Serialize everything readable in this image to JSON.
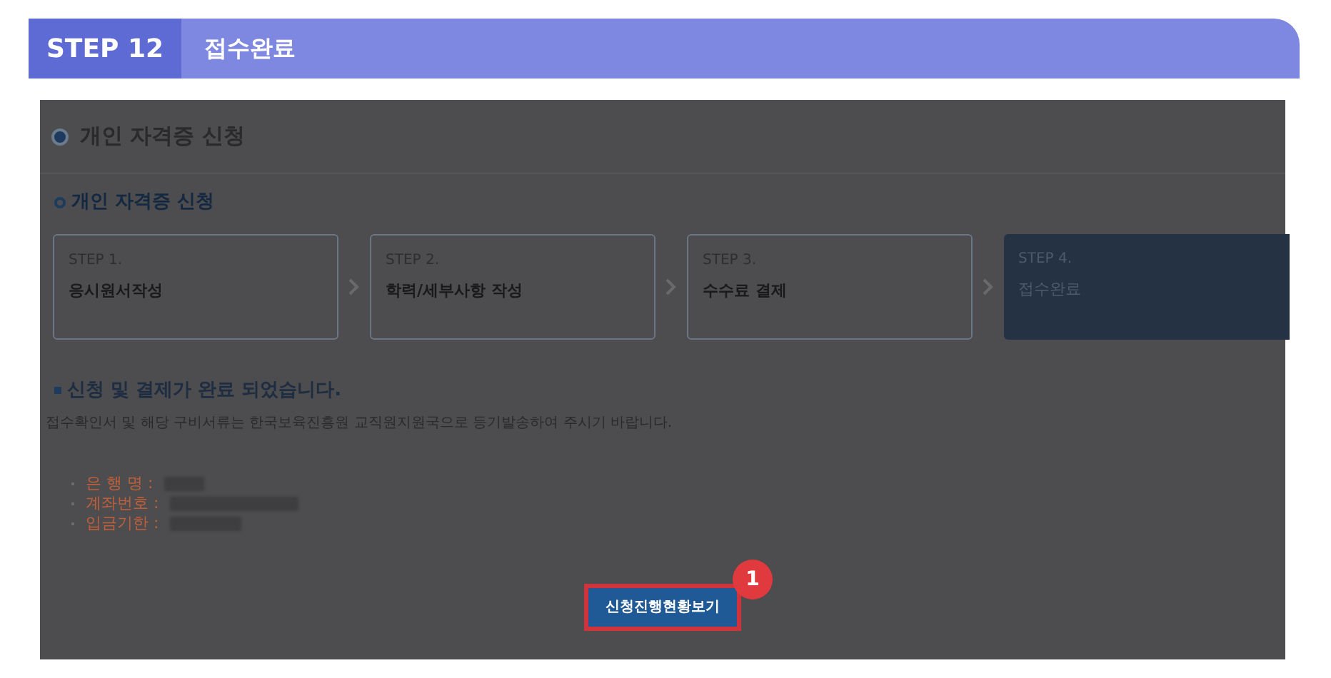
{
  "header": {
    "step": "STEP 12",
    "title": "접수완료"
  },
  "screenshot": {
    "page_title": "개인 자격증 신청",
    "section_title": "개인 자격증 신청",
    "steps": [
      {
        "label": "STEP 1.",
        "name": "응시원서작성",
        "selected": false
      },
      {
        "label": "STEP 2.",
        "name": "학력/세부사항 작성",
        "selected": false
      },
      {
        "label": "STEP 3.",
        "name": "수수료 결제",
        "selected": false
      },
      {
        "label": "STEP 4.",
        "name": "접수완료",
        "selected": true
      }
    ],
    "message": "신청 및 결제가 완료 되었습니다.",
    "notice": "접수확인서 및 해당 구비서류는 한국보육진흥원 교직원지원국으로 등기발송하여 주시기 바랍니다.",
    "bank_info": [
      {
        "label": "은 행 명 :"
      },
      {
        "label": "계좌번호 :"
      },
      {
        "label": "입금기한 :"
      }
    ],
    "button": "신청진행현황보기",
    "badge": "1"
  }
}
